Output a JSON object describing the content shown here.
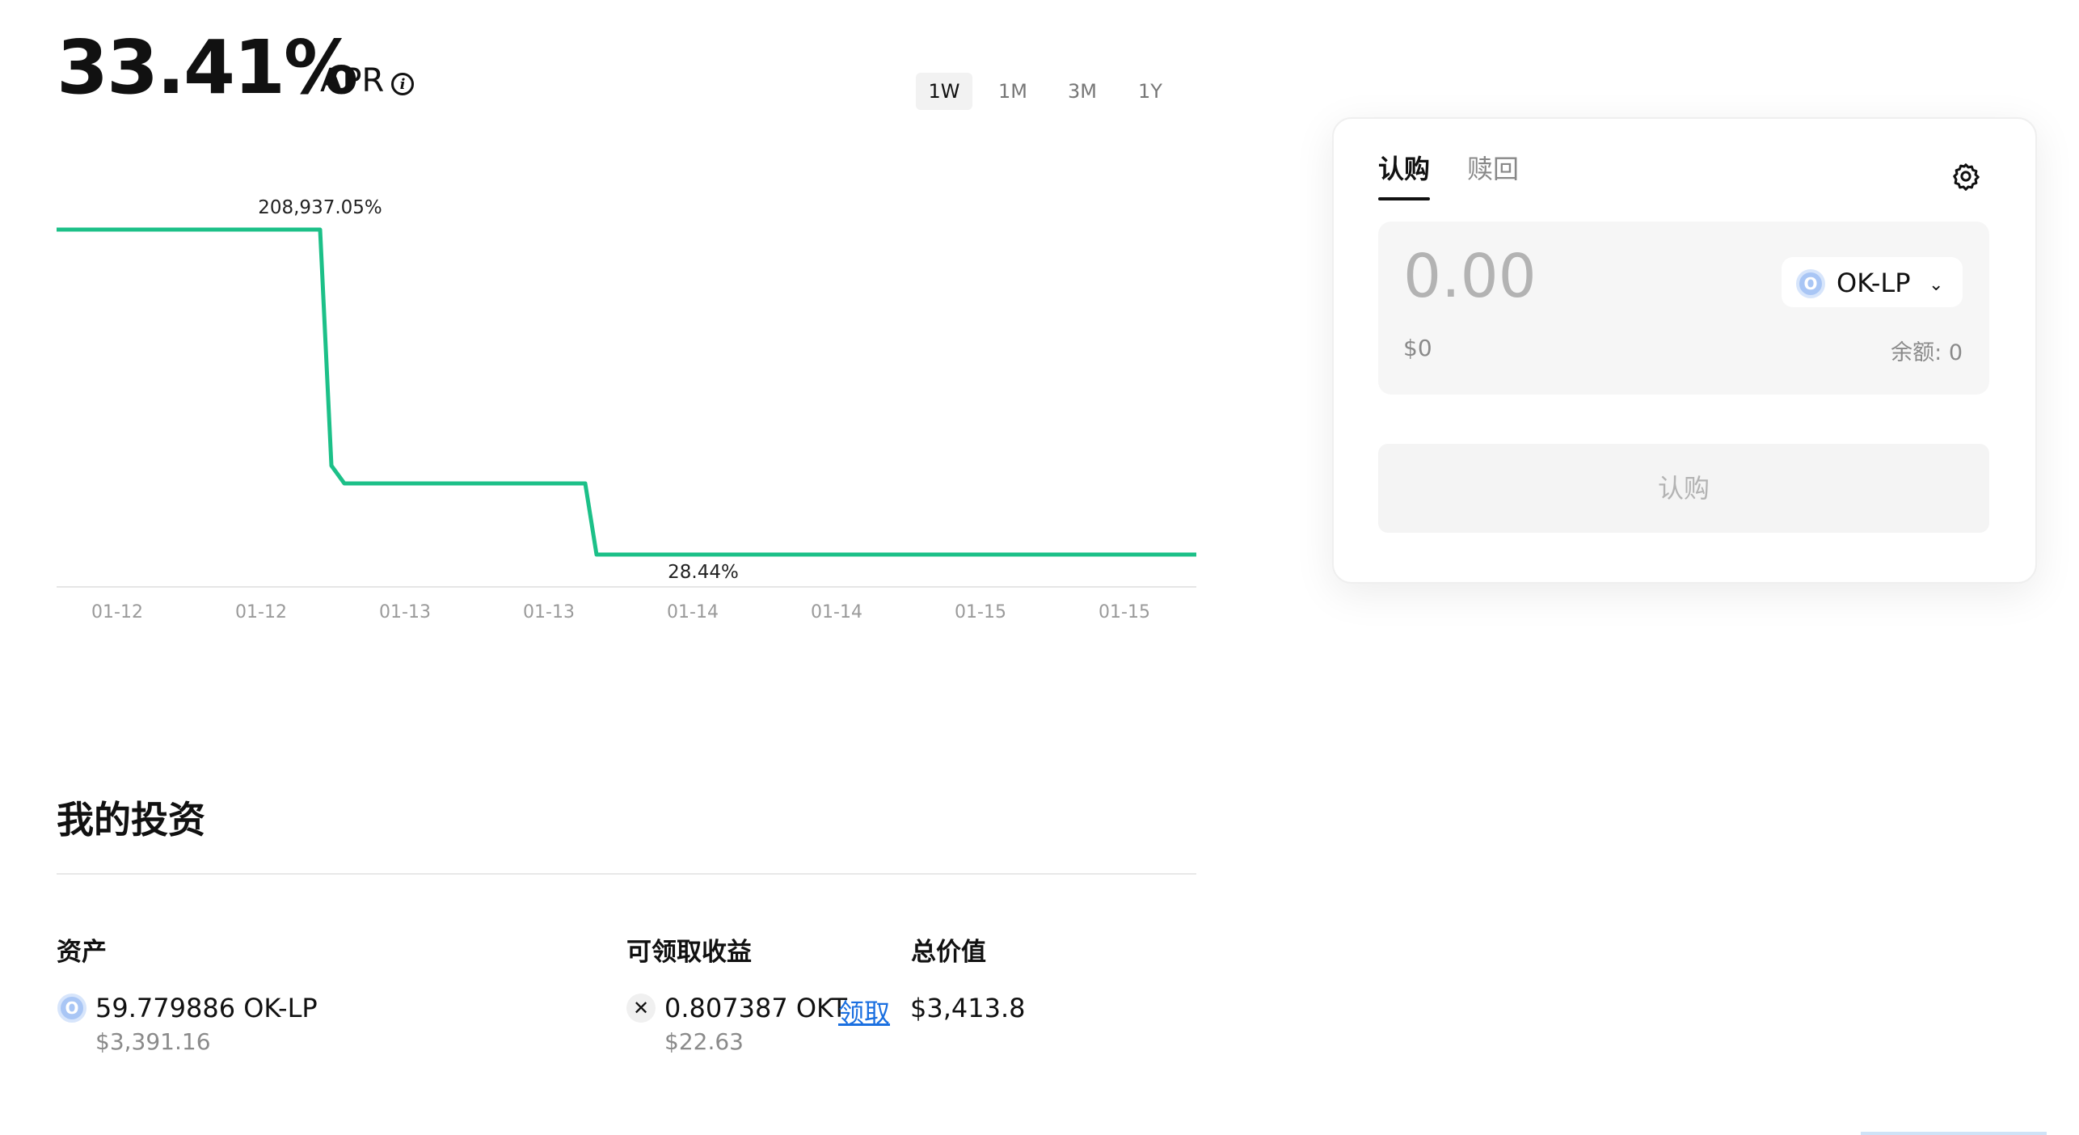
{
  "header": {
    "apr_value": "33.41%",
    "apr_label": "APR",
    "info_icon": "info-icon",
    "ranges": [
      "1W",
      "1M",
      "3M",
      "1Y"
    ],
    "active_range": "1W"
  },
  "chart_data": {
    "type": "line",
    "x": [
      "01-12",
      "01-12",
      "01-13",
      "01-13",
      "01-14",
      "01-14",
      "01-15",
      "01-15"
    ],
    "series": [
      {
        "values": [
          208937.05,
          208937.05,
          28.44,
          28.44,
          28.44,
          28.44,
          28.44,
          28.44
        ]
      }
    ],
    "annotations": {
      "max_label": "208,937.05%",
      "min_label": "28.44%"
    },
    "color": "#1cc088",
    "grid": false
  },
  "investment": {
    "title": "我的投资",
    "col_asset": "资产",
    "col_claimable": "可领取收益",
    "col_total": "总价值",
    "asset_amount": "59.779886 OK-LP",
    "asset_usd": "$3,391.16",
    "claimable_amount": "0.807387 OKT",
    "claim_link": "领取",
    "claimable_usd": "$22.63",
    "total_value": "$3,413.8",
    "coin_glyph": "O"
  },
  "panel": {
    "tab_buy": "认购",
    "tab_redeem": "赎回",
    "settings_icon": "gear-icon",
    "amount_placeholder": "0.00",
    "usd_value": "$0",
    "balance_label": "余额: 0",
    "token": "OK-LP",
    "coin_glyph": "O",
    "submit_label": "认购"
  },
  "colors": {
    "accent_line": "#1cc088",
    "link": "#1a6fe0"
  }
}
